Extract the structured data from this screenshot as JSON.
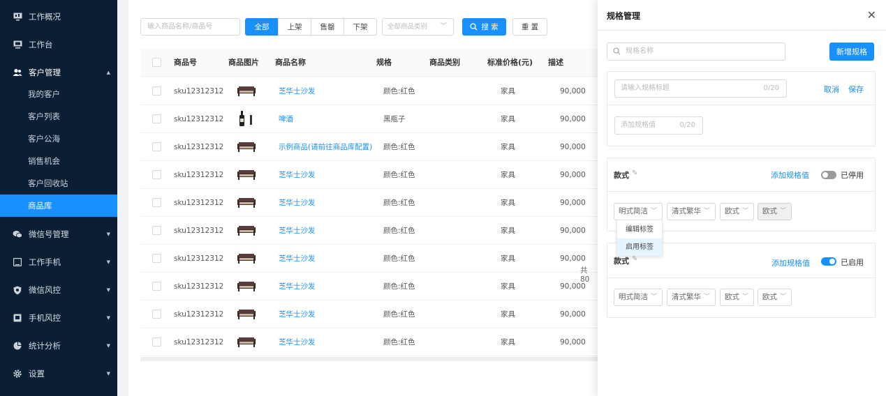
{
  "sidebar": {
    "items": [
      {
        "label": "工作概况",
        "icon": "monitor-icon"
      },
      {
        "label": "工作台",
        "icon": "desktop-icon"
      },
      {
        "label": "客户管理",
        "icon": "users-icon",
        "expanded": true,
        "children": [
          "我的客户",
          "客户列表",
          "客户公海",
          "销售机会",
          "客户回收站",
          "商品库"
        ],
        "active_child": "商品库"
      },
      {
        "label": "微信号管理",
        "icon": "wechat-icon"
      },
      {
        "label": "工作手机",
        "icon": "phone-icon"
      },
      {
        "label": "微信风控",
        "icon": "shield-icon"
      },
      {
        "label": "手机风控",
        "icon": "mobile-shield-icon"
      },
      {
        "label": "统计分析",
        "icon": "pie-chart-icon"
      },
      {
        "label": "设置",
        "icon": "gear-icon"
      }
    ]
  },
  "filters": {
    "search_placeholder": "输入商品名称/商品号",
    "status_tabs": [
      "全部",
      "上架",
      "售罄",
      "下架"
    ],
    "active_tab": "全部",
    "category_placeholder": "全部商品类别",
    "search_button": "搜 索",
    "reset_button": "重 置"
  },
  "table": {
    "columns": [
      "商品号",
      "商品图片",
      "商品名称",
      "规格",
      "商品类别",
      "标准价格(元)",
      "描述"
    ],
    "rows": [
      {
        "sku": "sku12312312",
        "image": "sofa",
        "name": "芝华士沙发",
        "spec": "颜色:红色",
        "category": "",
        "price_label": "家具",
        "desc": "90,000"
      },
      {
        "sku": "sku12312312",
        "image": "beer",
        "name": "啤酒",
        "spec": "黑瓶子",
        "category": "",
        "price_label": "家具",
        "desc": "90,000"
      },
      {
        "sku": "sku12312312",
        "image": "sofa",
        "name": "示例商品(请前往商品库配置)",
        "spec": "颜色:红色",
        "category": "",
        "price_label": "家具",
        "desc": "90,000"
      },
      {
        "sku": "sku12312312",
        "image": "sofa",
        "name": "芝华士沙发",
        "spec": "颜色:红色",
        "category": "",
        "price_label": "家具",
        "desc": "90,000"
      },
      {
        "sku": "sku12312312",
        "image": "sofa",
        "name": "芝华士沙发",
        "spec": "颜色:红色",
        "category": "",
        "price_label": "家具",
        "desc": "90,000"
      },
      {
        "sku": "sku12312312",
        "image": "sofa",
        "name": "芝华士沙发",
        "spec": "颜色:红色",
        "category": "",
        "price_label": "家具",
        "desc": "90,000"
      },
      {
        "sku": "sku12312312",
        "image": "sofa",
        "name": "芝华士沙发",
        "spec": "颜色:红色",
        "category": "",
        "price_label": "家具",
        "desc": "90,000"
      },
      {
        "sku": "sku12312312",
        "image": "sofa",
        "name": "芝华士沙发",
        "spec": "颜色:红色",
        "category": "",
        "price_label": "家具",
        "desc": "90,000"
      },
      {
        "sku": "sku12312312",
        "image": "sofa",
        "name": "芝华士沙发",
        "spec": "颜色:红色",
        "category": "",
        "price_label": "家具",
        "desc": "90,000"
      },
      {
        "sku": "sku12312312",
        "image": "sofa",
        "name": "芝华士沙发",
        "spec": "颜色:红色",
        "category": "",
        "price_label": "家具",
        "desc": "90,000"
      }
    ],
    "total_peek": "共 80"
  },
  "drawer": {
    "title": "规格管理",
    "search_placeholder": "规格名称",
    "add_button": "新增规格",
    "new_spec": {
      "title_placeholder": "请输入规格标题",
      "title_count": "0/20",
      "cancel": "取消",
      "save": "保存",
      "value_placeholder": "添加规格值",
      "value_count": "0/20"
    },
    "groups": [
      {
        "label": "款式",
        "add_value": "添加规格值",
        "status": "已停用",
        "enabled": false,
        "values": [
          "明式简洁",
          "清式繁华",
          "欧式",
          "欧式"
        ]
      },
      {
        "label": "款式",
        "add_value": "添加规格值",
        "status": "已启用",
        "enabled": true,
        "values": [
          "明式简洁",
          "清式繁华",
          "欧式",
          "欧式"
        ]
      }
    ],
    "context_menu": [
      "编辑标签",
      "启用标签"
    ]
  },
  "colors": {
    "sidebar_bg": "#0a1f33",
    "accent": "#1890ff",
    "toggle_off": "#9a9a9a"
  }
}
